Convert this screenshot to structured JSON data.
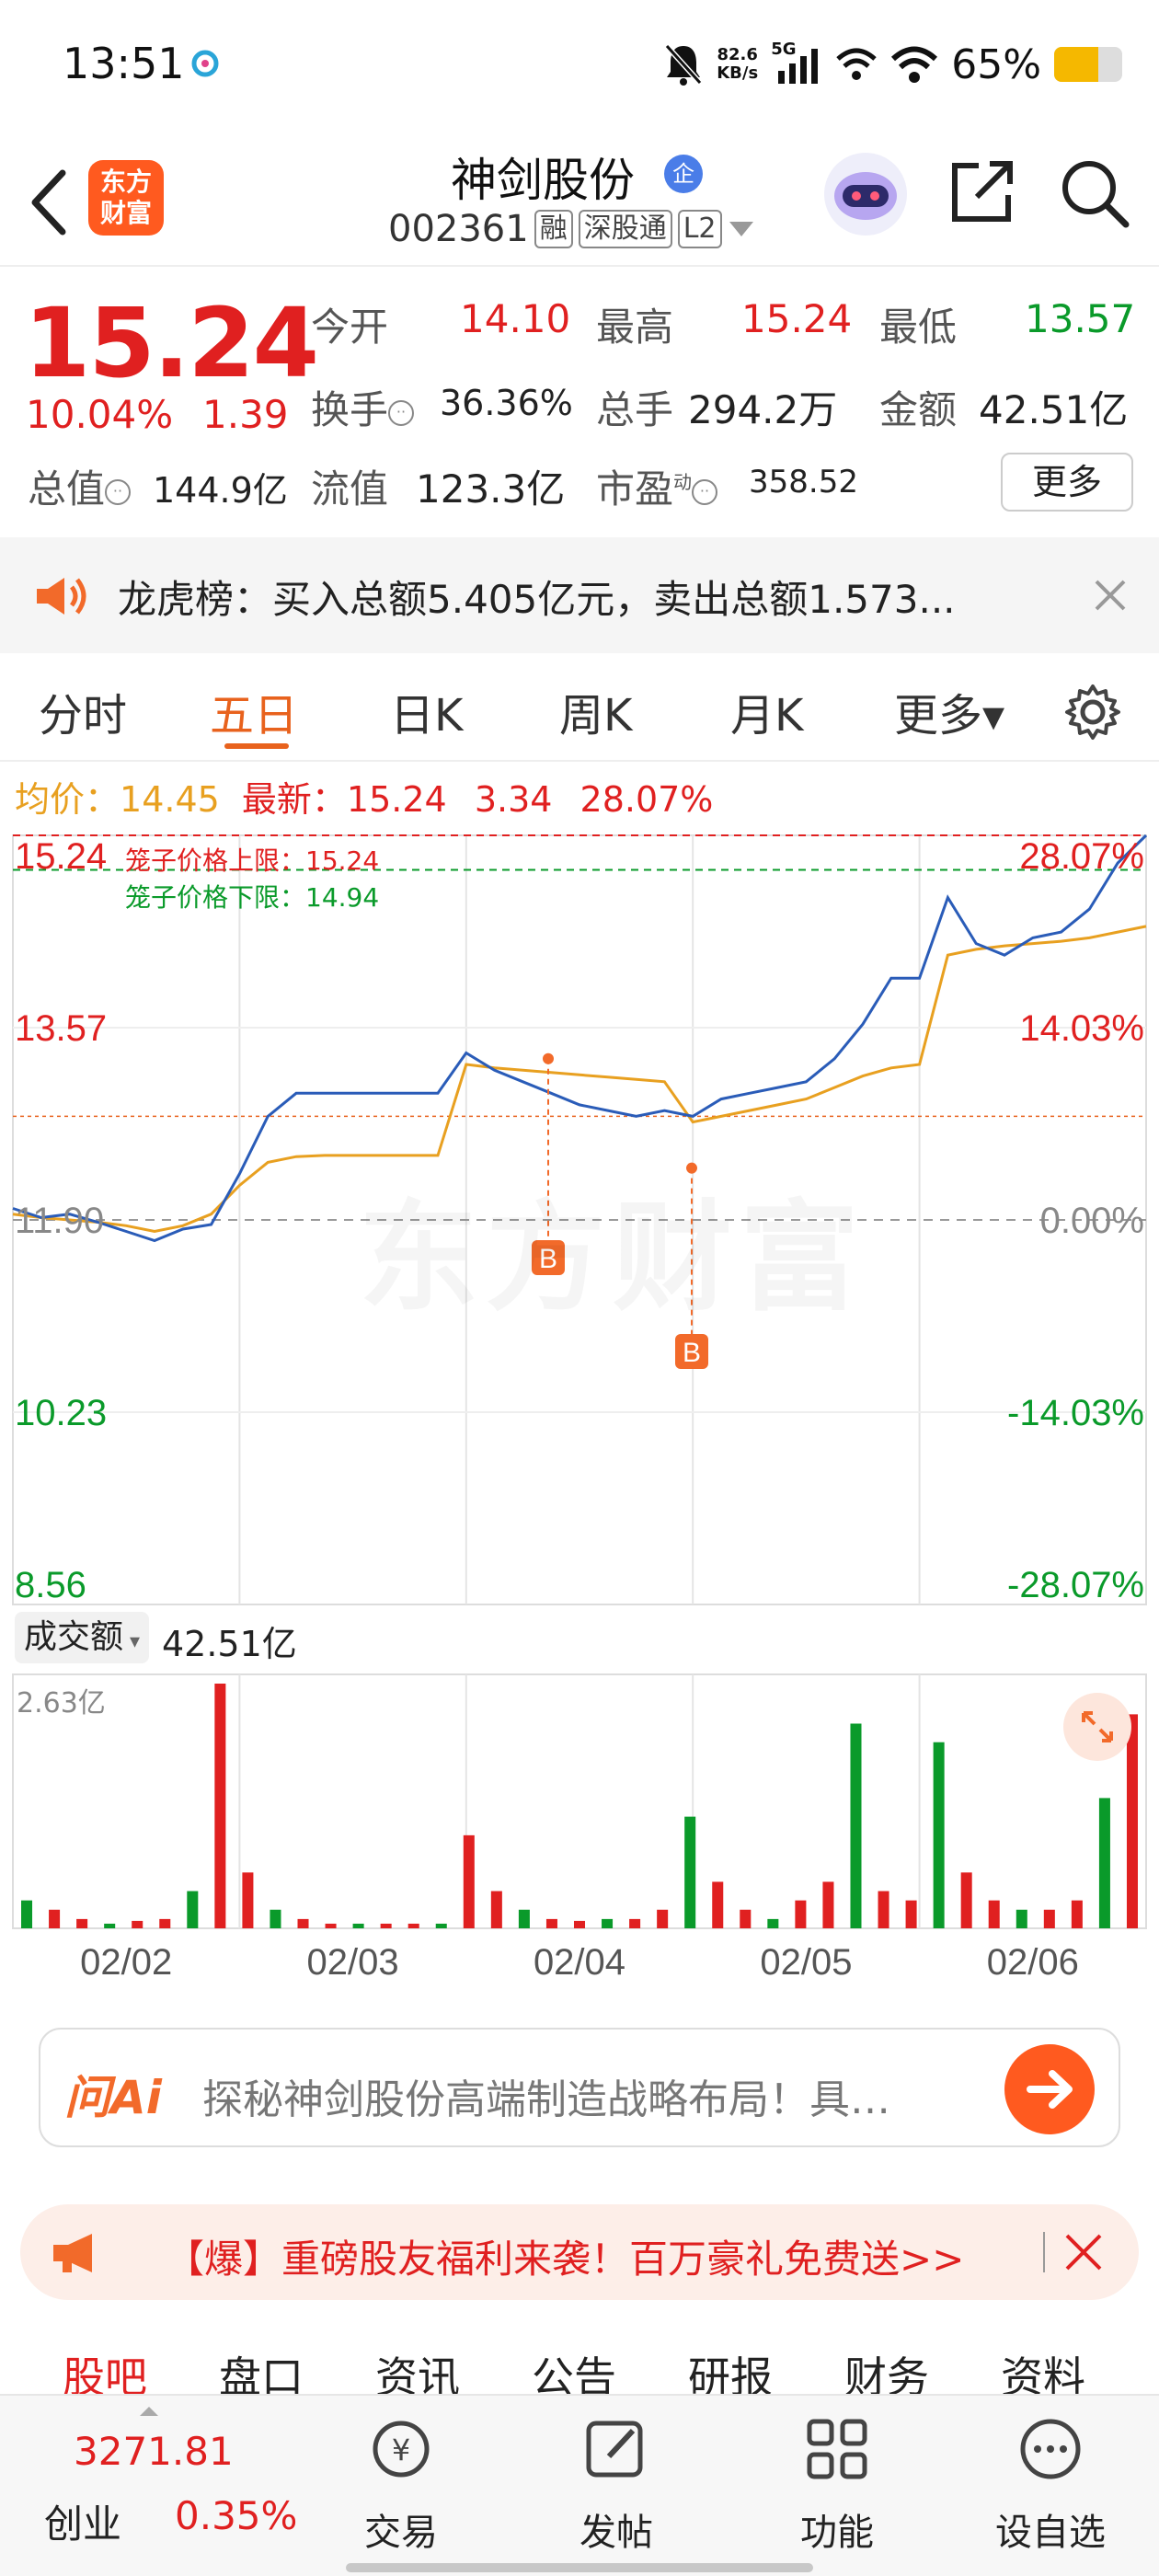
{
  "status": {
    "time": "13:51",
    "speed_value": "82.6",
    "speed_unit": "KB/s",
    "net_type": "5G",
    "battery": "65%"
  },
  "nav": {
    "logo_line1": "东方",
    "logo_line2": "财富",
    "stock_name": "神剑股份",
    "stock_badge": "企",
    "stock_code": "002361",
    "tags": [
      "融",
      "深股通",
      "L2"
    ]
  },
  "quote": {
    "price": "15.24",
    "change_pct": "10.04%",
    "change_amt": "1.39",
    "open_label": "今开",
    "open": "14.10",
    "high_label": "最高",
    "high": "15.24",
    "low_label": "最低",
    "low": "13.57",
    "turnover_label": "换手",
    "turnover": "36.36%",
    "volume_label": "总手",
    "volume": "294.2万",
    "amount_label": "金额",
    "amount": "42.51亿",
    "mcap_label": "总值",
    "mcap": "144.9亿",
    "float_label": "流值",
    "float_cap": "123.3亿",
    "pe_label": "市盈",
    "pe_sup": "动",
    "pe": "358.52",
    "more_label": "更多"
  },
  "banner": {
    "text": "龙虎榜：买入总额5.405亿元，卖出总额1.573..."
  },
  "tabs": [
    {
      "label": "分时"
    },
    {
      "label": "五日"
    },
    {
      "label": "日K"
    },
    {
      "label": "周K"
    },
    {
      "label": "月K"
    },
    {
      "label": "更多▾"
    }
  ],
  "chart_header": {
    "avg_label": "均价：",
    "avg": "14.45",
    "last_label": "最新：",
    "last": "15.24",
    "chg": "3.34",
    "chg_pct": "28.07%"
  },
  "watermark": "东方财富",
  "chart_data": {
    "type": "line",
    "x_labels": [
      "02/02",
      "02/03",
      "02/04",
      "02/05",
      "02/06"
    ],
    "y_ticks_left": [
      "15.24",
      "13.57",
      "11.90",
      "10.23",
      "8.56"
    ],
    "y_ticks_right": [
      "28.07%",
      "14.03%",
      "0.00%",
      "-14.03%",
      "-28.07%"
    ],
    "ylim": [
      8.56,
      15.24
    ],
    "cage_upper_label": "笼子价格上限：15.24",
    "cage_lower_label": "笼子价格下限：14.94",
    "buy_marker": "B",
    "series": [
      {
        "name": "price",
        "color": "#2a5cb8",
        "values": [
          12.0,
          11.92,
          11.95,
          11.88,
          11.8,
          11.72,
          11.82,
          11.86,
          12.3,
          12.8,
          13.0,
          13.0,
          13.0,
          13.0,
          13.0,
          13.0,
          13.35,
          13.2,
          13.1,
          13.0,
          12.9,
          12.85,
          12.8,
          12.85,
          12.8,
          12.95,
          13.0,
          13.05,
          13.1,
          13.3,
          13.6,
          14.0,
          14.0,
          14.7,
          14.3,
          14.2,
          14.35,
          14.4,
          14.6,
          15.0,
          15.24
        ]
      },
      {
        "name": "avg",
        "color": "#e8a020",
        "values": [
          11.95,
          11.92,
          11.9,
          11.88,
          11.85,
          11.8,
          11.85,
          11.95,
          12.2,
          12.4,
          12.45,
          12.46,
          12.46,
          12.46,
          12.46,
          12.46,
          13.25,
          13.22,
          13.2,
          13.18,
          13.16,
          13.14,
          13.12,
          13.1,
          12.75,
          12.8,
          12.85,
          12.9,
          12.95,
          13.05,
          13.15,
          13.22,
          13.25,
          14.2,
          14.25,
          14.28,
          14.3,
          14.32,
          14.35,
          14.4,
          14.45
        ]
      }
    ],
    "volume": {
      "label": "成交额",
      "total": "42.51亿",
      "max_label": "2.63亿",
      "max": 2.63,
      "values": [
        0.3,
        0.2,
        0.1,
        0.05,
        0.08,
        0.1,
        0.4,
        2.63,
        0.6,
        0.2,
        0.1,
        0.05,
        0.05,
        0.05,
        0.05,
        0.05,
        1.0,
        0.4,
        0.2,
        0.1,
        0.08,
        0.1,
        0.1,
        0.2,
        1.2,
        0.5,
        0.2,
        0.1,
        0.3,
        0.5,
        2.2,
        0.4,
        0.3,
        2.0,
        0.6,
        0.3,
        0.2,
        0.2,
        0.3,
        1.4,
        2.3
      ]
    }
  },
  "ai_box": {
    "brand": "问Ai",
    "prompt": "探秘神剑股份高端制造战略布局！具…"
  },
  "promo": {
    "text": "【爆】重磅股友福利来袭！百万豪礼免费送>>"
  },
  "section_tabs": [
    "股吧",
    "盘口",
    "资讯",
    "公告",
    "研报",
    "财务",
    "资料"
  ],
  "footer": {
    "index_value": "3271.81",
    "index_name": "创业",
    "index_chg": "0.35%",
    "items": [
      "交易",
      "发帖",
      "功能",
      "设自选"
    ]
  },
  "colors": {
    "up": "#e02020",
    "down": "#0a9a2a",
    "accent": "#e8621d",
    "price_line": "#2a5cb8",
    "avg_line": "#e8a020"
  }
}
